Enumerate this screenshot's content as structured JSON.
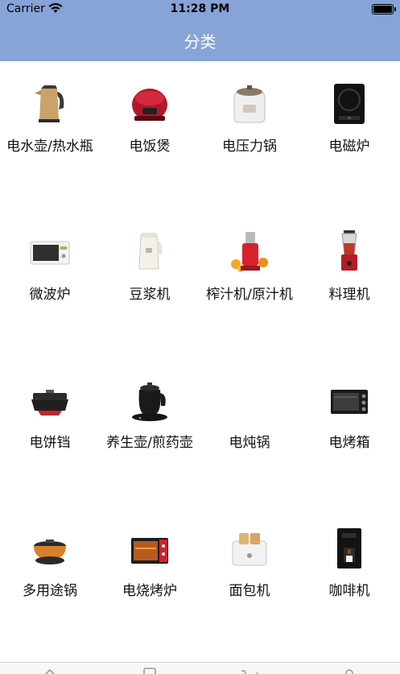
{
  "status": {
    "carrier": "Carrier",
    "time": "11:28 PM"
  },
  "nav": {
    "title": "分类"
  },
  "categories": [
    {
      "label": "电水壶/热水瓶",
      "icon": "electric-kettle-icon"
    },
    {
      "label": "电饭煲",
      "icon": "rice-cooker-icon"
    },
    {
      "label": "电压力锅",
      "icon": "pressure-cooker-icon"
    },
    {
      "label": "电磁炉",
      "icon": "induction-cooker-icon"
    },
    {
      "label": "微波炉",
      "icon": "microwave-icon"
    },
    {
      "label": "豆浆机",
      "icon": "soymilk-maker-icon"
    },
    {
      "label": "榨汁机/原汁机",
      "icon": "juicer-icon"
    },
    {
      "label": "料理机",
      "icon": "blender-icon"
    },
    {
      "label": "电饼铛",
      "icon": "electric-griddle-icon"
    },
    {
      "label": "养生壶/煎药壶",
      "icon": "health-pot-icon"
    },
    {
      "label": "电炖锅",
      "icon": ""
    },
    {
      "label": "电烤箱",
      "icon": "electric-oven-icon"
    },
    {
      "label": "多用途锅",
      "icon": "multi-cooker-icon"
    },
    {
      "label": "电烧烤炉",
      "icon": "grill-oven-icon"
    },
    {
      "label": "面包机",
      "icon": "bread-maker-icon"
    },
    {
      "label": "咖啡机",
      "icon": "coffee-machine-icon"
    }
  ],
  "tabbar": [
    {
      "icon": "home-icon"
    },
    {
      "icon": "category-icon"
    },
    {
      "icon": "cart-icon"
    },
    {
      "icon": "profile-icon"
    }
  ]
}
